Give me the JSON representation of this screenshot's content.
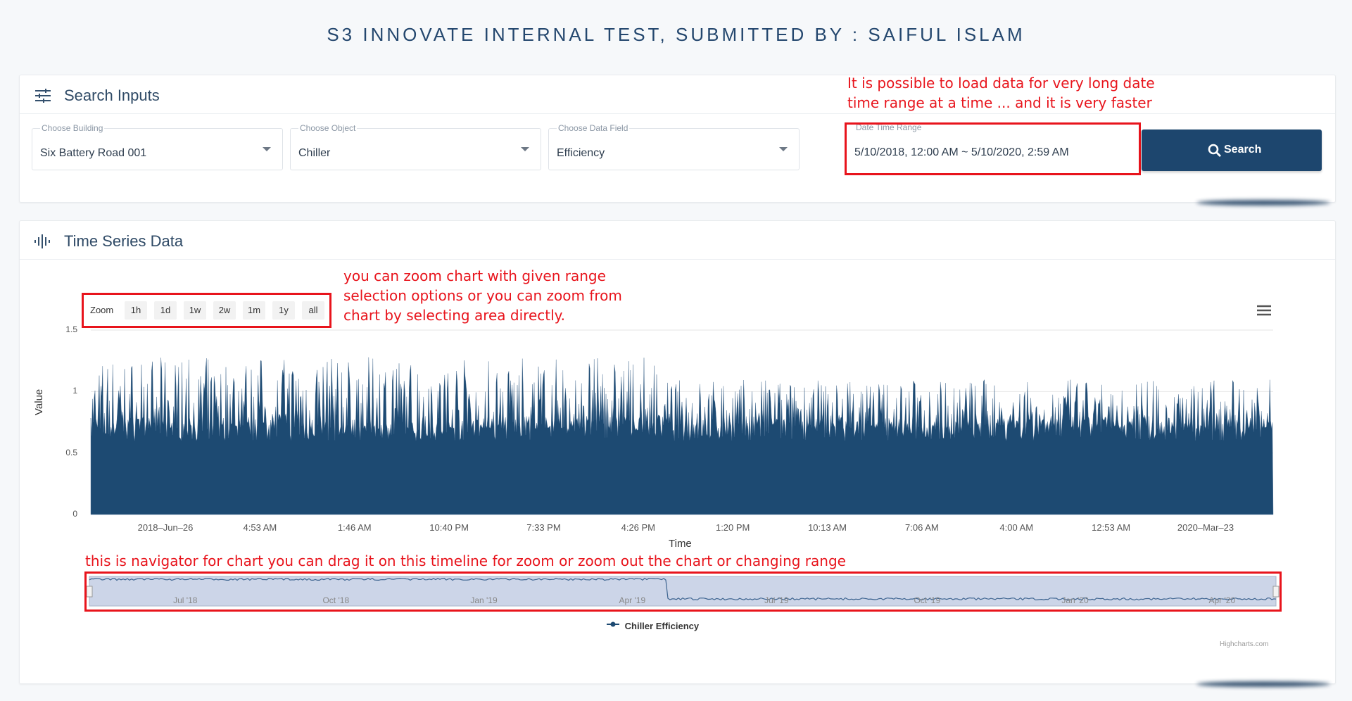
{
  "page": {
    "title": "S3 INNOVATE INTERNAL TEST, SUBMITTED BY : SAIFUL ISLAM"
  },
  "search_card": {
    "title": "Search Inputs",
    "icon": "sliders-icon",
    "building": {
      "label": "Choose Building",
      "value": "Six Battery Road 001"
    },
    "object": {
      "label": "Choose Object",
      "value": "Chiller"
    },
    "data_field": {
      "label": "Choose Data Field",
      "value": "Efficiency"
    },
    "date_range": {
      "label": "Date Time Range",
      "value": "5/10/2018, 12:00 AM ~ 5/10/2020, 2:59 AM"
    },
    "search_button": {
      "label": "Search",
      "icon": "search-icon",
      "color": "#1d466e"
    }
  },
  "chart_card": {
    "title": "Time Series Data",
    "icon": "waveform-icon",
    "zoom_label": "Zoom",
    "zoom_buttons": [
      "1h",
      "1d",
      "1w",
      "2w",
      "1m",
      "1y",
      "all"
    ],
    "menu_icon": "hamburger-menu-icon",
    "legend": "Chiller Efficiency",
    "credits": "Highcharts.com"
  },
  "annotations": {
    "date_range_note": [
      "It is possible to load data for very long date",
      "time range  at a time ... and it is very faster"
    ],
    "zoom_note": [
      "you can zoom chart with given range",
      "selection options or you can zoom from",
      "chart by selecting area directly."
    ],
    "navigator_note": "this is navigator for chart you can drag it on this timeline for zoom or zoom out the chart or changing range",
    "color": "#e8141c"
  },
  "chart_data": {
    "type": "area",
    "title": "",
    "xlabel": "Time",
    "ylabel": "Value",
    "ylim": [
      0,
      1.5
    ],
    "y_ticks": [
      "0",
      "0.5",
      "1",
      "1.5"
    ],
    "x_tick_labels": [
      "2018–Jun–26",
      "4:53 AM",
      "1:46 AM",
      "10:40 PM",
      "7:33 PM",
      "4:26 PM",
      "1:20 PM",
      "10:13 AM",
      "7:06 AM",
      "4:00 AM",
      "12:53 AM",
      "2020–Mar–23"
    ],
    "series": [
      {
        "name": "Chiller Efficiency",
        "color": "#1d4a72",
        "baseline_approx": 0.6,
        "spike_range_before_apr19": [
          0.7,
          1.28
        ],
        "spike_range_after_apr19": [
          0.7,
          1.1
        ]
      }
    ],
    "x_range": [
      "2018-05-10",
      "2020-05-10"
    ],
    "navigator_ticks": [
      "Jul '18",
      "Oct '18",
      "Jan '19",
      "Apr '19",
      "Jul '19",
      "Oct '19",
      "Jan '20",
      "Apr '20"
    ],
    "grid": true,
    "legend_position": "bottom-center"
  }
}
